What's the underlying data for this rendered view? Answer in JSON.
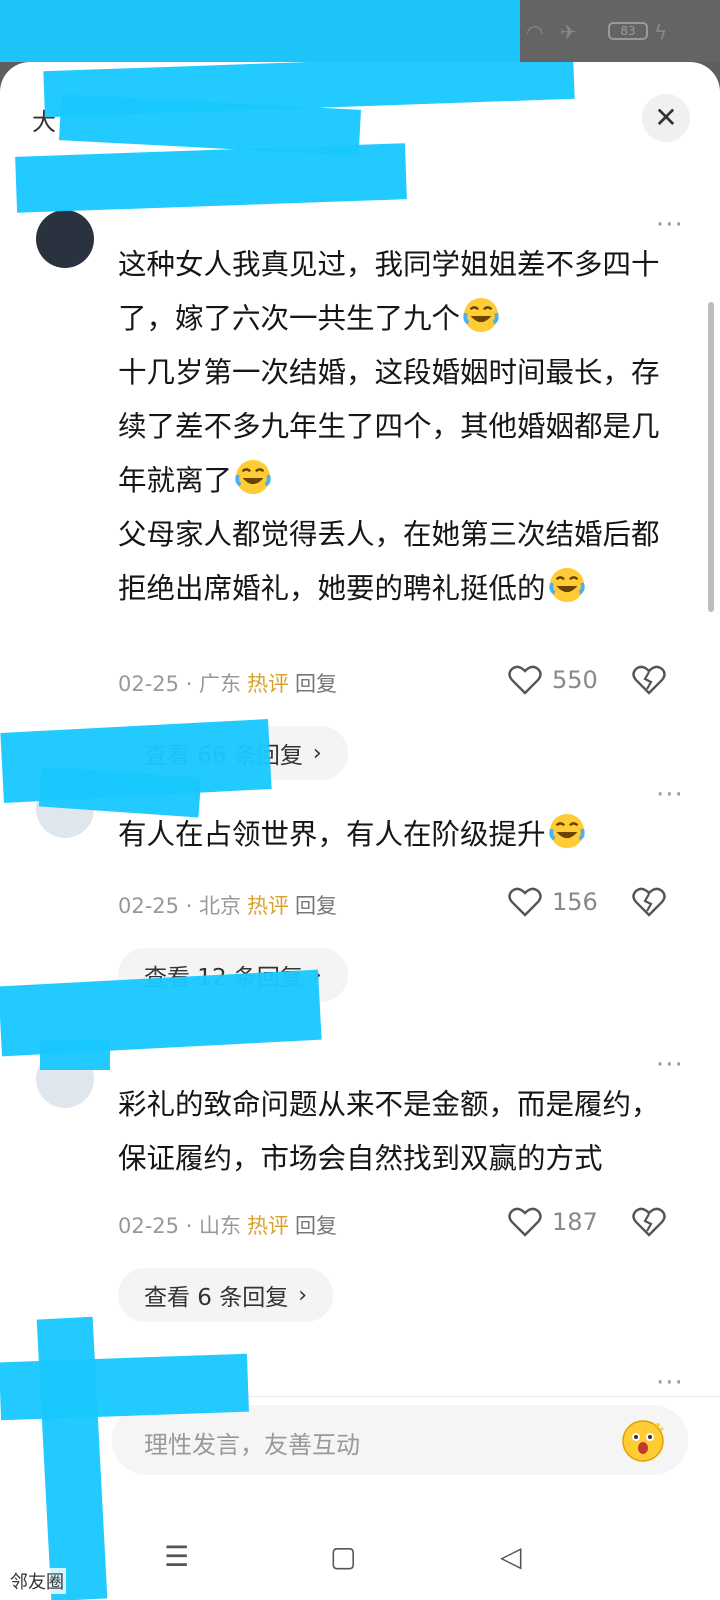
{
  "status_bar": {
    "battery": "83"
  },
  "header": {
    "title": "大"
  },
  "comments": [
    {
      "lines": [
        "这种女人我真见过，我同学姐姐差不多四十",
        "了，嫁了六次一共生了九个",
        "十几岁第一次结婚，这段婚姻时间最长，存",
        "续了差不多九年生了四个，其他婚姻都是几",
        "年就离了",
        "父母家人都觉得丢人，在她第三次结婚后都",
        "拒绝出席婚礼，她要的聘礼挺低的"
      ],
      "emoji_lines": [
        1,
        4,
        6
      ],
      "date": "02-25 · 广东",
      "hot": "热评",
      "reply": "回复",
      "likes": "550",
      "view_replies": "查看 66 条回复"
    },
    {
      "lines": [
        "有人在占领世界，有人在阶级提升"
      ],
      "emoji_lines": [
        0
      ],
      "date": "02-25 · 北京",
      "hot": "热评",
      "reply": "回复",
      "likes": "156",
      "view_replies": "查看 12 条回复"
    },
    {
      "lines": [
        "彩礼的致命问题从来不是金额，而是履约，",
        "保证履约，市场会自然找到双赢的方式"
      ],
      "emoji_lines": [],
      "date": "02-25 · 山东",
      "hot": "热评",
      "reply": "回复",
      "likes": "187",
      "view_replies": "查看 6 条回复"
    }
  ],
  "input": {
    "placeholder": "理性发言，友善互动"
  },
  "watermark": "邻友圈",
  "icons": {
    "close": "close-icon",
    "more": "more-icon",
    "like": "heart-icon",
    "dislike": "broken-heart-icon",
    "emoji": "emoji-face-icon",
    "nav": [
      "menu-icon",
      "home-square-icon",
      "back-triangle-icon"
    ]
  },
  "colors": {
    "hot": "#d9a32a",
    "redaction": "#19c8ff",
    "background": "#ffffff"
  }
}
